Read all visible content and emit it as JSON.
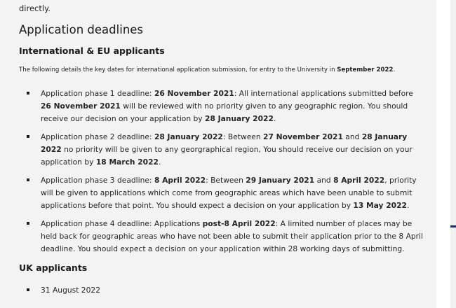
{
  "top_fragment": "directly.",
  "headings": {
    "deadlines": "Application deadlines",
    "international": "International & EU applicants",
    "uk": "UK applicants"
  },
  "intro": {
    "text": "The following details the key dates for international application submission, for entry to the University in ",
    "date": "September 2022",
    "end": "."
  },
  "phases": [
    {
      "label": "Application phase 1 deadline: ",
      "deadline": "26 November 2021",
      "t1": ": All international applications submitted before ",
      "b1": "26 November 2021",
      "t2": " will be reviewed with no priority given to any geographic region. You should receive our decision on your application by ",
      "b2": "28 January 2022",
      "t3": "."
    },
    {
      "label": "Application phase 2 deadline: ",
      "deadline": "28 January 2022",
      "t1": ": Between ",
      "b1": "27 November 2021",
      "t2": " and ",
      "b2": "28 January 2022",
      "t3": " no priority will be given to any georgraphical region, You should receive our decision on your application by ",
      "b3": "18 March 2022",
      "t4": "."
    },
    {
      "label": "Application phase 3 deadline: ",
      "deadline": "8 April 2022",
      "t1": ": Between ",
      "b1": "29 January 2021",
      "t2": " and ",
      "b2": "8 April 2022",
      "t3": ", priority will be given to applications which come from geographic areas which have been unable to submit applications before that point. You should expect a decision on your application by ",
      "b3": "13 May 2022",
      "t4": "."
    },
    {
      "label": "Application phase 4 deadline: Applications ",
      "deadline": "post-8 April 2022",
      "t1": ": A limited number of places may be held back for geographic areas who have not been able to submit their application prior to the 8 April deadline. You should expect a decision on your application within 28 working days of submitting."
    }
  ],
  "uk_items": [
    "31 August 2022"
  ]
}
